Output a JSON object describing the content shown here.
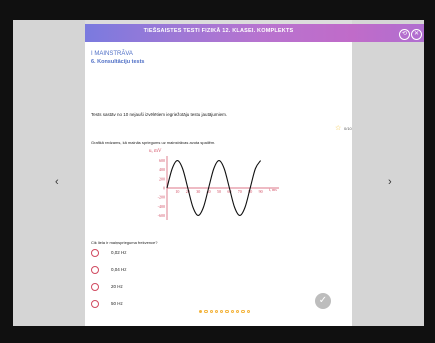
{
  "header": {
    "title": "TIEŠSAISTES TESTI FIZIKĀ 12. KLASEI. KOMPLEKTS",
    "icons": [
      "back-arrow-icon",
      "close-icon"
    ]
  },
  "breadcrumb": {
    "level1": "I MAINSTRĀVA",
    "level2": "6. Konsultāciju tests"
  },
  "intro_text": "Tests sastāv no 10 nejauši izvēlētiem iegriežotāju testu jautājumiem.",
  "progress": {
    "count": "0/10",
    "dots_total": 10,
    "active_index": 0
  },
  "question": {
    "prompt": "Grafikā redzams, kā mainās spriegums uz mainstrāvas avota spailēm.",
    "question": "Cik liela ir maiņsprieguma frekvence?",
    "options": [
      "0,02 Hz",
      "0,04 Hz",
      "20 Hz",
      "50 Hz"
    ]
  },
  "chart_data": {
    "type": "line",
    "title": "",
    "xlabel": "t, ms",
    "ylabel": "u, mV",
    "x_ticks": [
      10,
      20,
      30,
      40,
      50,
      60,
      70,
      80,
      90
    ],
    "y_ticks": [
      -600,
      -400,
      -200,
      0,
      200,
      400,
      600
    ],
    "series": [
      {
        "name": "",
        "x": [
          0,
          5,
          10,
          15,
          20,
          25,
          30,
          35,
          40,
          45,
          50,
          55,
          60,
          65,
          70,
          75,
          80,
          85,
          90
        ],
        "values": [
          0,
          424,
          600,
          424,
          0,
          -424,
          -600,
          -424,
          0,
          424,
          600,
          424,
          0,
          -424,
          -600,
          -424,
          0,
          424,
          600
        ]
      }
    ],
    "ylim": [
      -700,
      700
    ],
    "xlim": [
      0,
      100
    ],
    "grid": false
  },
  "navigation": {
    "left_label": "‹",
    "right_label": "›",
    "check_label": "✓"
  }
}
